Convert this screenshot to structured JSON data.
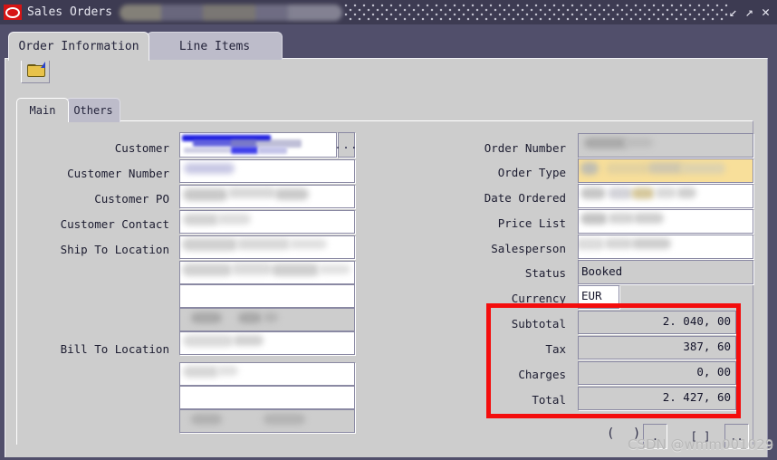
{
  "window": {
    "title": "Sales Orders",
    "app_icon": "oracle-oval-icon",
    "controls": {
      "restore": "↙",
      "maximize": "↗",
      "close": "✕"
    }
  },
  "tabs": [
    {
      "label": "Order Information",
      "active": true
    },
    {
      "label": "Line Items",
      "active": false
    }
  ],
  "toolbar": {
    "open_icon": "open-folder-icon"
  },
  "inner_tabs": [
    {
      "label": "Main",
      "active": true
    },
    {
      "label": "Others",
      "active": false
    }
  ],
  "left_fields": [
    {
      "label": "Customer",
      "value": "",
      "lov": "..."
    },
    {
      "label": "Customer Number",
      "value": ""
    },
    {
      "label": "Customer PO",
      "value": ""
    },
    {
      "label": "Customer Contact",
      "value": ""
    },
    {
      "label": "Ship To Location",
      "value": ""
    },
    {
      "label": "",
      "value": ""
    },
    {
      "label": "",
      "value": ""
    },
    {
      "label": "",
      "value": ""
    },
    {
      "label": "Bill To Location",
      "value": ""
    },
    {
      "label": "",
      "value": ""
    },
    {
      "label": "",
      "value": ""
    },
    {
      "label": "",
      "value": ""
    }
  ],
  "right_fields": [
    {
      "label": "Order Number",
      "value": "",
      "style": "gray"
    },
    {
      "label": "Order Type",
      "value": "",
      "style": "yellow"
    },
    {
      "label": "Date Ordered",
      "value": "",
      "style": "white"
    },
    {
      "label": "Price List",
      "value": "",
      "style": "white"
    },
    {
      "label": "Salesperson",
      "value": "",
      "style": "white"
    },
    {
      "label": "Status",
      "value": "Booked",
      "style": "gray"
    },
    {
      "label": "Currency",
      "value": "EUR",
      "style": "white"
    }
  ],
  "totals": {
    "highlight_color": "#f40d0d",
    "rows": [
      {
        "label": "Subtotal",
        "value": "2. 040, 00"
      },
      {
        "label": "Tax",
        "value": "387, 60"
      },
      {
        "label": "Charges",
        "value": "0, 00"
      },
      {
        "label": "Total",
        "value": "2. 427, 60"
      }
    ]
  },
  "footer": {
    "parens": "(  )",
    "buttons": [
      ".",
      "[ ]",
      ".."
    ],
    "watermark": "CSDN @wmm001029"
  }
}
